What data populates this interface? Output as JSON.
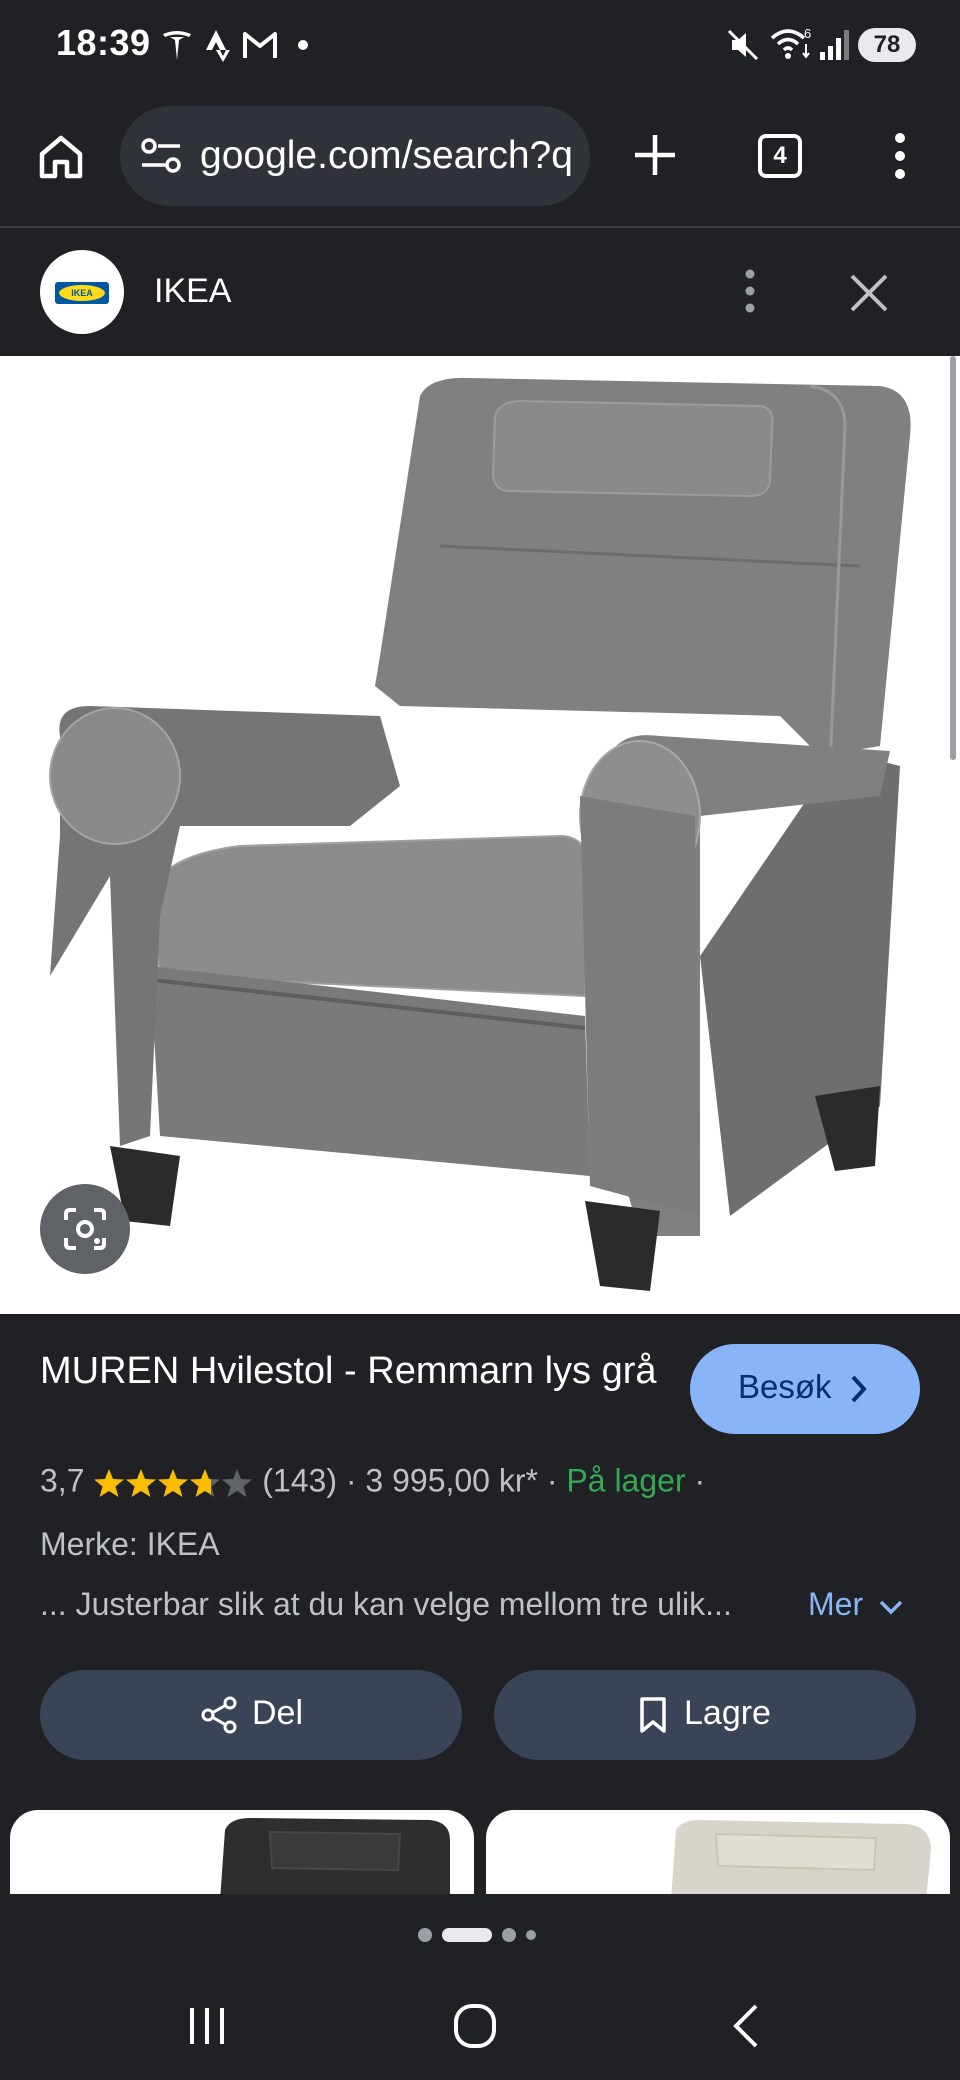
{
  "status_bar": {
    "time": "18:39",
    "battery": "78",
    "icons": [
      "tesla-icon",
      "strava-icon",
      "gmail-icon",
      "dot-icon",
      "mute-icon",
      "wifi-icon",
      "signal-icon"
    ]
  },
  "browser": {
    "url": "google.com/search?q",
    "tab_count": "4"
  },
  "source": {
    "name": "IKEA",
    "logo_text": "IKEA"
  },
  "product": {
    "title": "MUREN Hvilestol - Remmarn lys grå",
    "visit_label": "Besøk",
    "rating": "3,7",
    "rating_value": 3.7,
    "rating_max": 5,
    "review_count": "(143)",
    "separator": "·",
    "price": "3 995,00 kr*",
    "stock": "På lager",
    "brand": "Merke: IKEA",
    "description": "... Justerbar slik at du kan velge mellom tre ulik...",
    "more_label": "Mer",
    "share_label": "Del",
    "save_label": "Lagre"
  },
  "carousel": {
    "page_count": 4,
    "active_index": 1
  },
  "colors": {
    "background": "#1f2125",
    "accent": "#8ab4f8",
    "stock_green": "#34a853",
    "button_bg": "#394457",
    "star": "#fbbc04"
  }
}
